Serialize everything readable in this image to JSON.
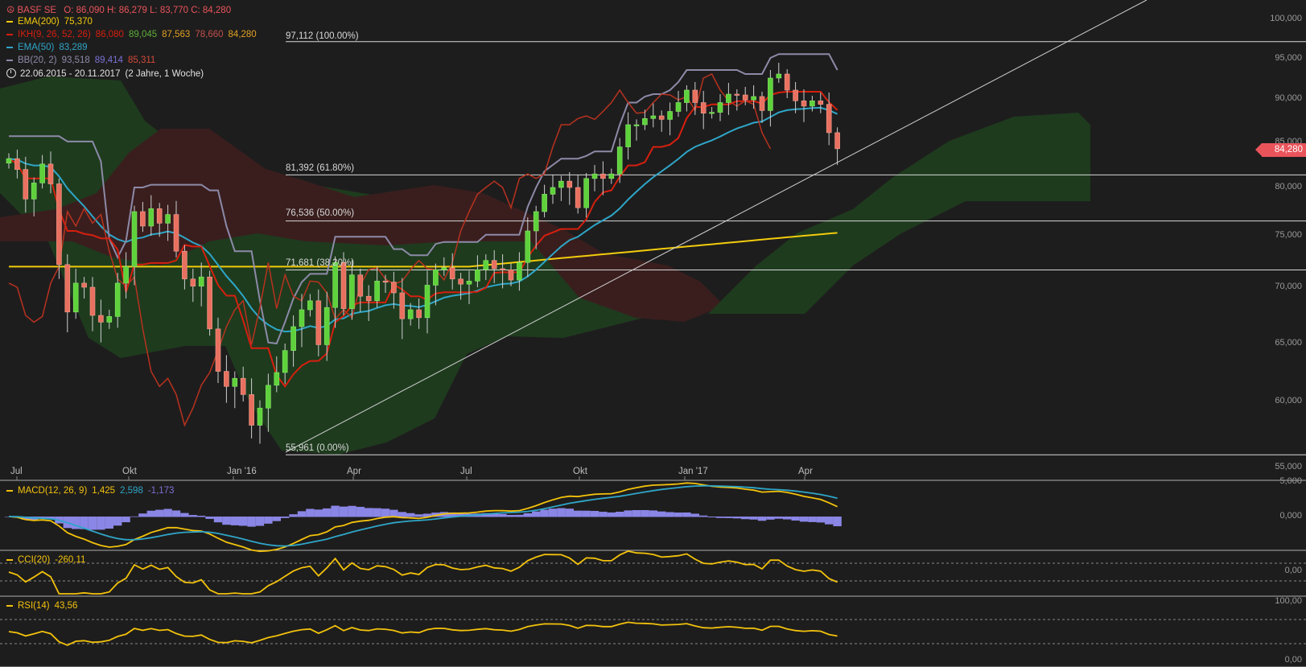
{
  "header": {
    "symbol": "BASF SE",
    "ohlc": "O: 86,090  H: 86,279  L: 83,770  C: 84,280",
    "ema200_label": "EMA(200)",
    "ema200_value": "75,370",
    "ikh_label": "IKH(9, 26, 52, 26)",
    "ikh_v1": "86,080",
    "ikh_v2": "89,045",
    "ikh_v3": "87,563",
    "ikh_v4": "78,660",
    "ikh_v5": "84,280",
    "ema50_label": "EMA(50)",
    "ema50_value": "83,289",
    "bb_label": "BB(20, 2)",
    "bb_v1": "93,518",
    "bb_v2": "89,414",
    "bb_v3": "85,311",
    "range": "22.06.2015 - 20.11.2017",
    "range_note": "(2 Jahre, 1 Woche)"
  },
  "colors": {
    "up": "#5ed23b",
    "down": "#e9705f",
    "ema200": "#f2cc0c",
    "ikh": "#d61f0e",
    "ema50": "#2ea6c8",
    "bb": "#8d8aa8",
    "cloud_green": "#1e3b1e",
    "cloud_red": "#3a1e1e",
    "macd": "#f2c20c",
    "signal": "#2ea6c8",
    "hist": "#8a86e6",
    "cci": "#f2c20c",
    "rsi": "#f2c20c",
    "badge": "#e9545b"
  },
  "last_price": "84,280",
  "fib_levels": [
    {
      "value": 97.112,
      "label": "97,112 (100.00%)"
    },
    {
      "value": 81.392,
      "label": "81,392 (61.80%)"
    },
    {
      "value": 76.536,
      "label": "76,536 (50.00%)"
    },
    {
      "value": 71.681,
      "label": "71,681 (38.20%)"
    },
    {
      "value": 55.961,
      "label": "55,961 (0.00%)"
    }
  ],
  "y_axis_labels": [
    "100,000",
    "95,000",
    "90,000",
    "85,000",
    "80,000",
    "75,000",
    "70,000",
    "65,000",
    "60,000",
    "55,000"
  ],
  "x_axis_labels": [
    "Jul",
    "Okt",
    "Jan '16",
    "Apr",
    "Jul",
    "Okt",
    "Jan '17",
    "Apr"
  ],
  "macd_panel": {
    "label": "MACD(12, 26, 9)",
    "v1": "1,425",
    "v2": "2,598",
    "v3": "-1,173",
    "y_labels": [
      "5,000",
      "0,000"
    ]
  },
  "cci_panel": {
    "label": "CCI(20)",
    "value": "-260,11",
    "y_labels": [
      "0,00"
    ]
  },
  "rsi_panel": {
    "label": "RSI(14)",
    "value": "43,56",
    "y_labels": [
      "100,00",
      "0,00"
    ]
  },
  "chart_data": {
    "type": "candlestick",
    "x_start": "2015-06-22",
    "x_end": "2017-11-20",
    "interval": "week",
    "closes": [
      83.2,
      82.0,
      78.8,
      80.5,
      82.6,
      80.4,
      72.2,
      67.8,
      70.4,
      70.0,
      67.5,
      66.9,
      67.4,
      70.4,
      72.0,
      77.5,
      76.0,
      77.8,
      76.3,
      77.2,
      73.5,
      70.8,
      70.1,
      71.0,
      66.3,
      62.6,
      61.3,
      62.0,
      60.6,
      58.2,
      59.5,
      61.4,
      62.5,
      64.4,
      66.5,
      68.0,
      68.8,
      64.9,
      68.2,
      72.4,
      68.1,
      71.2,
      69.2,
      68.8,
      70.6,
      70.5,
      69.5,
      67.2,
      68.0,
      67.3,
      70.2,
      71.7,
      71.9,
      70.8,
      70.3,
      70.6,
      71.7,
      72.6,
      71.8,
      71.7,
      70.7,
      72.4,
      75.5,
      77.5,
      79.3,
      80.0,
      80.7,
      80.0,
      77.9,
      81.0,
      81.5,
      81.0,
      81.5,
      84.5,
      87.0,
      87.0,
      87.7,
      88.0,
      87.6,
      88.5,
      89.5,
      91.0,
      89.5,
      88.3,
      88.4,
      89.5,
      90.5,
      90.4,
      89.8,
      90.2,
      88.6,
      92.5,
      93.0,
      91.0,
      89.7,
      89.1,
      89.7,
      89.3,
      86.1,
      84.3
    ],
    "ema200_range": [
      "72.0",
      "75.37"
    ],
    "current": {
      "open": 86.09,
      "high": 86.279,
      "low": 83.77,
      "close": 84.28
    }
  }
}
